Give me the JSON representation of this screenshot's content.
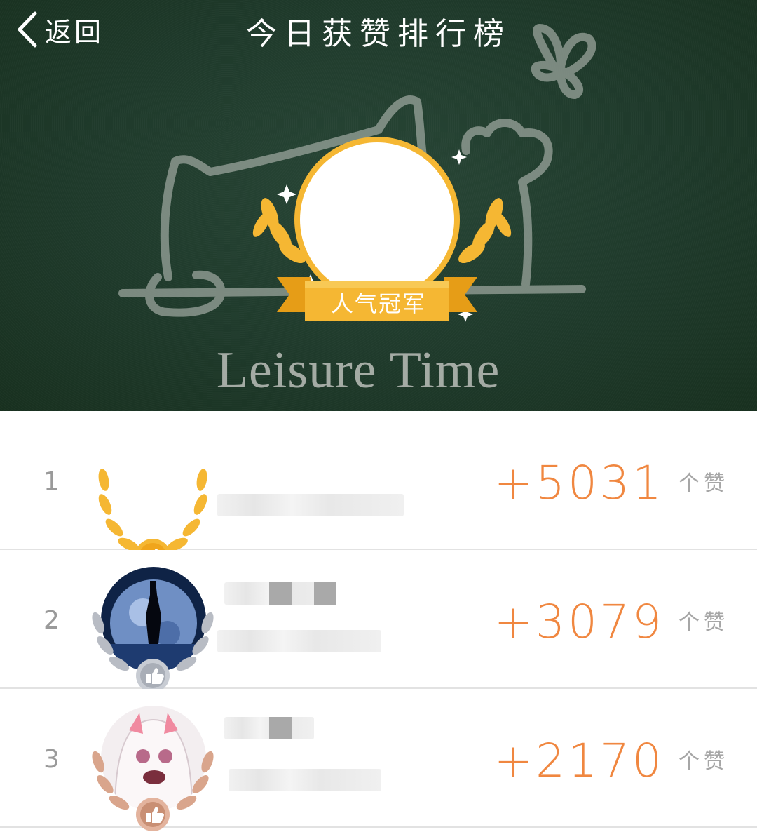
{
  "header": {
    "back_label": "返回",
    "title": "今日获赞排行榜",
    "banner_text": "Leisure Time",
    "crest_label": "人气冠军"
  },
  "colors": {
    "banner_bg": "#1f3a2b",
    "score": "#f08740",
    "gold": "#f5b733",
    "silver": "#b8bcc4",
    "bronze": "#d9a58c"
  },
  "ranking": [
    {
      "rank": "1",
      "score": "+5031",
      "unit": "个赞",
      "medal": "gold"
    },
    {
      "rank": "2",
      "score": "+3079",
      "unit": "个赞",
      "medal": "silver"
    },
    {
      "rank": "3",
      "score": "+2170",
      "unit": "个赞",
      "medal": "bronze"
    }
  ]
}
